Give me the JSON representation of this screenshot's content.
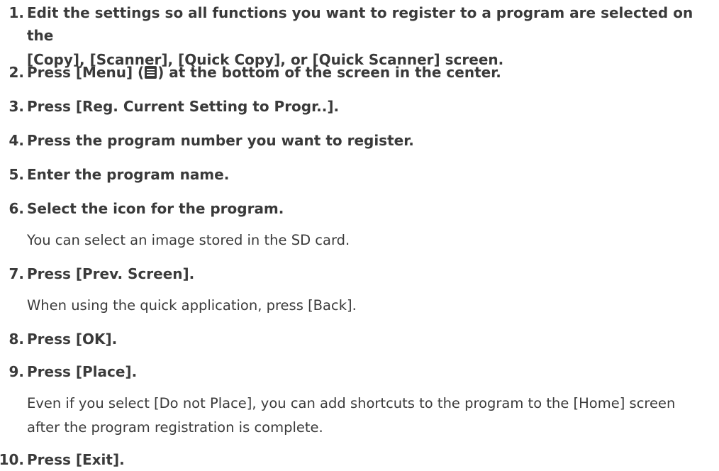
{
  "steps": [
    {
      "number": "1.",
      "line1": "Edit the settings so all functions you want to register to a program are selected on the",
      "line2": "[Copy], [Scanner], [Quick Copy], or [Quick Scanner] screen."
    },
    {
      "number": "2.",
      "before_icon": "Press [Menu] (",
      "icon": "menu-icon",
      "after_icon": ") at the bottom of the screen in the center."
    },
    {
      "number": "3.",
      "text": "Press [Reg. Current Setting to Progr..]."
    },
    {
      "number": "4.",
      "text": "Press the program number you want to register."
    },
    {
      "number": "5.",
      "text": "Enter the program name."
    },
    {
      "number": "6.",
      "text": "Select the icon for the program.",
      "note": "You can select an image stored in the SD card."
    },
    {
      "number": "7.",
      "text": "Press [Prev. Screen].",
      "note": "When using the quick application, press [Back]."
    },
    {
      "number": "8.",
      "text": "Press [OK]."
    },
    {
      "number": "9.",
      "text": "Press [Place].",
      "note_line1": "Even if you select [Do not Place], you can add shortcuts to the program to the [Home] screen",
      "note_line2": "after the program registration is complete."
    },
    {
      "number": "10.",
      "text": "Press [Exit]."
    }
  ]
}
